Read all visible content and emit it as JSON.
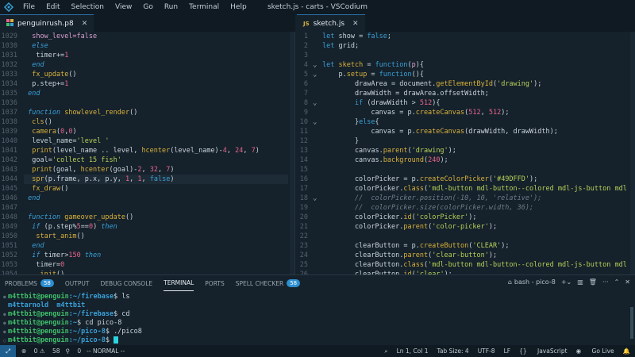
{
  "titlebar": {
    "menu": [
      "File",
      "Edit",
      "Selection",
      "View",
      "Go",
      "Run",
      "Terminal",
      "Help"
    ],
    "title": "sketch.js - carts - VSCodium"
  },
  "left_tab": {
    "label": "penguinrush.p8"
  },
  "right_tab": {
    "label": "sketch.js",
    "icon_text": "JS"
  },
  "left_editor": {
    "lines": [
      {
        "n": "1029",
        "html": "  <span class=\"pm\">show_level=false</span>"
      },
      {
        "n": "1030",
        "html": "  <span class=\"kwi\">else</span>"
      },
      {
        "n": "1031",
        "html": "   timer+=<span class=\"num\">1</span>"
      },
      {
        "n": "1032",
        "html": "  <span class=\"kwi\">end</span>"
      },
      {
        "n": "1033",
        "html": "  <span class=\"fn\">fx_update</span>()"
      },
      {
        "n": "1034",
        "html": "  p.step+=<span class=\"num\">1</span>"
      },
      {
        "n": "1035",
        "html": " <span class=\"kwi\">end</span>"
      },
      {
        "n": "1036",
        "html": ""
      },
      {
        "n": "1037",
        "html": " <span class=\"kwi\">function</span> <span class=\"fn\">showlevel_render</span>()"
      },
      {
        "n": "1038",
        "html": "  <span class=\"fn\">cls</span>()"
      },
      {
        "n": "1039",
        "html": "  <span class=\"fn\">camera</span>(<span class=\"num\">0</span>,<span class=\"num\">0</span>)"
      },
      {
        "n": "1040",
        "html": "  level_name=<span class=\"str\">'level '</span>"
      },
      {
        "n": "1041",
        "html": "  <span class=\"fn\">print</span>(level_name .. level, <span class=\"fn\">hcenter</span>(level_name)-<span class=\"num\">4</span>, <span class=\"num\">24</span>, <span class=\"num\">7</span>)"
      },
      {
        "n": "1042",
        "html": "  goal=<span class=\"str\">'collect 15 fish'</span>"
      },
      {
        "n": "1043",
        "html": "  <span class=\"fn\">print</span>(goal, <span class=\"fn\">hcenter</span>(goal)-<span class=\"num\">2</span>, <span class=\"num\">32</span>, <span class=\"num\">7</span>)"
      },
      {
        "n": "1044",
        "html": "  <span class=\"fn\">spr</span>(p.frame, p.x, p.y, <span class=\"num\">1</span>, <span class=\"num\">1</span>, <span class=\"kw\">false</span>)",
        "hl": true
      },
      {
        "n": "1045",
        "html": "  <span class=\"fn\">fx_draw</span>()"
      },
      {
        "n": "1046",
        "html": " <span class=\"kwi\">end</span>"
      },
      {
        "n": "1047",
        "html": ""
      },
      {
        "n": "1048",
        "html": " <span class=\"kwi\">function</span> <span class=\"fn\">gameover_update</span>()"
      },
      {
        "n": "1049",
        "html": "  <span class=\"kwi\">if</span> (p.step%<span class=\"num\">5</span>==<span class=\"num\">0</span>) <span class=\"kwi\">then</span>"
      },
      {
        "n": "1050",
        "html": "   <span class=\"fn\">start_anim</span>()"
      },
      {
        "n": "1051",
        "html": "  <span class=\"kwi\">end</span>"
      },
      {
        "n": "1052",
        "html": "  <span class=\"kwi\">if</span> timer><span class=\"num\">150</span> <span class=\"kwi\">then</span>"
      },
      {
        "n": "1053",
        "html": "   timer=<span class=\"num\">0</span>"
      },
      {
        "n": "1054",
        "html": "   <span class=\"fn\">_init</span>()"
      }
    ]
  },
  "right_editor": {
    "lines": [
      {
        "n": "1",
        "f": "",
        "html": "<span class=\"kw\">let</span> show = <span class=\"kw\">false</span>;"
      },
      {
        "n": "2",
        "f": "",
        "html": "<span class=\"kw\">let</span> grid;"
      },
      {
        "n": "3",
        "f": "",
        "html": ""
      },
      {
        "n": "4",
        "f": "⌄",
        "html": "<span class=\"kw\">let</span> <span class=\"fn\">sketch</span> = <span class=\"kw\">function</span>(<span class=\"pm\">p</span>){"
      },
      {
        "n": "5",
        "f": "⌄",
        "html": "    p.<span class=\"fn\">setup</span> = <span class=\"kw\">function</span>(){"
      },
      {
        "n": "6",
        "f": "",
        "html": "        drawArea = document.<span class=\"fn\">getElementById</span>(<span class=\"str\">'drawing'</span>);"
      },
      {
        "n": "7",
        "f": "",
        "html": "        drawWidth = drawArea.offsetWidth;"
      },
      {
        "n": "8",
        "f": "⌄",
        "html": "        <span class=\"kw\">if</span> (drawWidth > <span class=\"num\">512</span>){"
      },
      {
        "n": "9",
        "f": "",
        "html": "            canvas = p.<span class=\"fn\">createCanvas</span>(<span class=\"num\">512</span>, <span class=\"num\">512</span>);"
      },
      {
        "n": "10",
        "f": "⌄",
        "html": "        }<span class=\"kw\">else</span>{"
      },
      {
        "n": "11",
        "f": "",
        "html": "            canvas = p.<span class=\"fn\">createCanvas</span>(drawWidth, drawWidth);"
      },
      {
        "n": "12",
        "f": "",
        "html": "        }"
      },
      {
        "n": "13",
        "f": "",
        "html": "        canvas.<span class=\"fn\">parent</span>(<span class=\"str\">'drawing'</span>);"
      },
      {
        "n": "14",
        "f": "",
        "html": "        canvas.<span class=\"fn\">background</span>(<span class=\"num\">240</span>);"
      },
      {
        "n": "15",
        "f": "",
        "html": ""
      },
      {
        "n": "16",
        "f": "",
        "html": "        colorPicker = p.<span class=\"fn\">createColorPicker</span>(<span class=\"str\">'#49DFFD'</span>);"
      },
      {
        "n": "17",
        "f": "",
        "html": "        colorPicker.<span class=\"fn\">class</span>(<span class=\"str\">'mdl-button mdl-button--colored mdl-js-button mdl</span>"
      },
      {
        "n": "18",
        "f": "⌄",
        "html": "        <span class=\"cm\">//  colorPicker.position(-10, 10, 'relative');</span>"
      },
      {
        "n": "19",
        "f": "",
        "html": "        <span class=\"cm\">//  colorPicker.size(colorPicker.width, 36);</span>"
      },
      {
        "n": "20",
        "f": "",
        "html": "        colorPicker.<span class=\"fn\">id</span>(<span class=\"str\">'colorPicker'</span>);"
      },
      {
        "n": "21",
        "f": "",
        "html": "        colorPicker.<span class=\"fn\">parent</span>(<span class=\"str\">'color-picker'</span>);"
      },
      {
        "n": "22",
        "f": "",
        "html": ""
      },
      {
        "n": "23",
        "f": "",
        "html": "        clearButton = p.<span class=\"fn\">createButton</span>(<span class=\"str\">'CLEAR'</span>);"
      },
      {
        "n": "24",
        "f": "",
        "html": "        clearButton.<span class=\"fn\">parent</span>(<span class=\"str\">'clear-button'</span>);"
      },
      {
        "n": "25",
        "f": "",
        "html": "        clearButton.<span class=\"fn\">class</span>(<span class=\"str\">'mdl-button mdl-button--colored mdl-js-button mdl</span>"
      },
      {
        "n": "26",
        "f": "",
        "html": "        clearButton.<span class=\"fn\">id</span>(<span class=\"str\">'clear'</span>);"
      }
    ]
  },
  "panel": {
    "tabs": [
      {
        "label": "PROBLEMS",
        "badge": "58"
      },
      {
        "label": "OUTPUT"
      },
      {
        "label": "DEBUG CONSOLE"
      },
      {
        "label": "TERMINAL",
        "active": true
      },
      {
        "label": "PORTS"
      },
      {
        "label": "SPELL CHECKER",
        "badge": "58"
      }
    ],
    "terminal_name": "bash - pico-8",
    "terminal": [
      {
        "user": "m4ttbit@penguin",
        "path": ":~/firebase",
        "cmd": "$ ls"
      },
      {
        "out": "m4ttarnold  m4ttbit"
      },
      {
        "user": "m4ttbit@penguin",
        "path": ":~/firebase",
        "cmd": "$ cd"
      },
      {
        "user": "m4ttbit@penguin",
        "path": ":~",
        "cmd": "$ cd pico-8"
      },
      {
        "user": "m4ttbit@penguin",
        "path": ":~/pico-8",
        "cmd": "$ ./pico8"
      },
      {
        "user": "m4ttbit@penguin",
        "path": ":~/pico-8",
        "cmd": "$ ",
        "cursor": true
      }
    ]
  },
  "statusbar": {
    "errors": "0",
    "warnings": "58",
    "ports": "0",
    "mode": "-- NORMAL --",
    "position": "Ln 1, Col 1",
    "tab_size": "Tab Size: 4",
    "encoding": "UTF-8",
    "eol": "LF",
    "language": "JavaScript",
    "go_live": "Go Live"
  },
  "colors": {
    "accent": "#2d8fd0",
    "background": "#15212b",
    "terminal_user": "#3fbf6a",
    "terminal_path": "#3aa0d8"
  }
}
